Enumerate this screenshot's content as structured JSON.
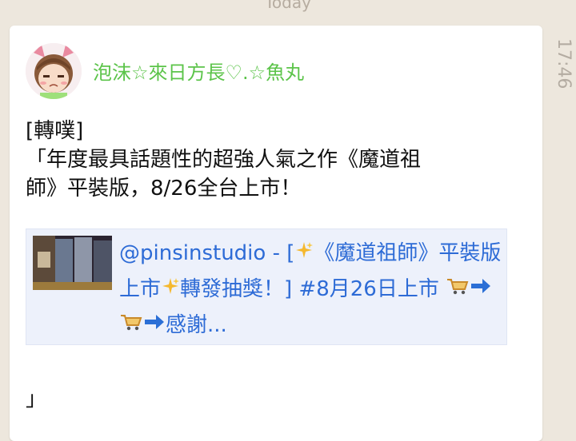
{
  "date_separator": "Today",
  "message": {
    "sender_name": "泡沫☆來日方長♡.☆魚丸",
    "tag": "[轉噗]",
    "body_line1": "「年度最具話題性的超強人氣之作《魔道祖",
    "body_line2": "師》平裝版，8/26全台上市！",
    "link_preview": {
      "part1": "@pinsinstudio - [",
      "part2": "《魔道祖師》平裝版上市",
      "part3": "轉發抽獎！] #8月26日上市 ",
      "part4": "感謝..."
    },
    "closing_quote": "」",
    "time": "17:46"
  },
  "colors": {
    "background": "#ede7dd",
    "sender_name": "#5cc44a",
    "link": "#2d6bd6",
    "link_card_bg": "#edf1fb",
    "time": "#b4aca2"
  },
  "icons": [
    "sparkles-icon",
    "shopping-cart-icon",
    "right-arrow-icon"
  ]
}
